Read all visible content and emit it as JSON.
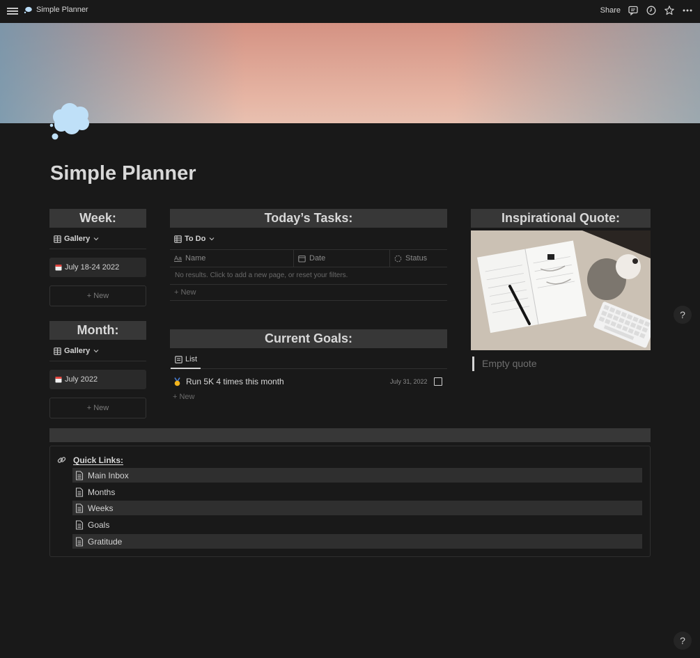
{
  "topbar": {
    "breadcrumb": "Simple Planner",
    "share_label": "Share"
  },
  "page": {
    "title": "Simple Planner"
  },
  "week": {
    "header": "Week:",
    "view_label": "Gallery",
    "card_label": "July 18-24 2022",
    "new_label": "New"
  },
  "month": {
    "header": "Month:",
    "view_label": "Gallery",
    "card_label": "July 2022",
    "new_label": "New"
  },
  "tasks": {
    "header": "Today’s Tasks:",
    "view_label": "To Do",
    "columns": [
      "Name",
      "Date",
      "Status"
    ],
    "empty_text": "No results. Click to add a new page, or reset your filters.",
    "new_label": "New"
  },
  "goals": {
    "header": "Current Goals:",
    "view_label": "List",
    "item_label": "Run 5K 4 times this month",
    "item_date": "July 31, 2022",
    "new_label": "New"
  },
  "quote": {
    "header": "Inspirational Quote:",
    "text": "Empty quote"
  },
  "quick_links": {
    "title": "Quick Links:",
    "items": [
      "Main Inbox",
      "Months",
      "Weeks",
      "Goals",
      "Gratitude"
    ]
  },
  "help_label": "?"
}
